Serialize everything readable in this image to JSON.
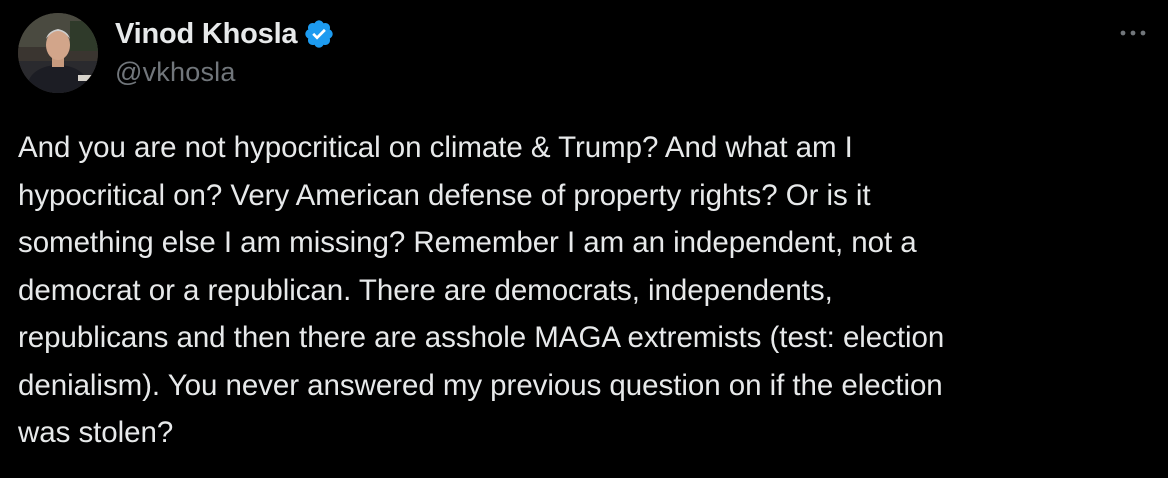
{
  "author": {
    "display_name": "Vinod Khosla",
    "handle": "@vkhosla",
    "verified_icon": "verified-badge-icon",
    "verified_color": "#1d9bf0"
  },
  "more_menu_icon": "more-options-icon",
  "tweet": {
    "text": "And you are not hypocritical on climate & Trump? And what am I\nhypocritical on? Very American defense of property rights? Or is it\nsomething else I am missing? Remember I am an independent, not a\ndemocrat or a republican. There are democrats, independents,\nrepublicans and then there are asshole MAGA extremists (test: election\ndenialism). You never answered my previous question on if the election\nwas stolen?"
  },
  "colors": {
    "background": "#000000",
    "primary_text": "#e7e9ea",
    "secondary_text": "#71767b"
  }
}
